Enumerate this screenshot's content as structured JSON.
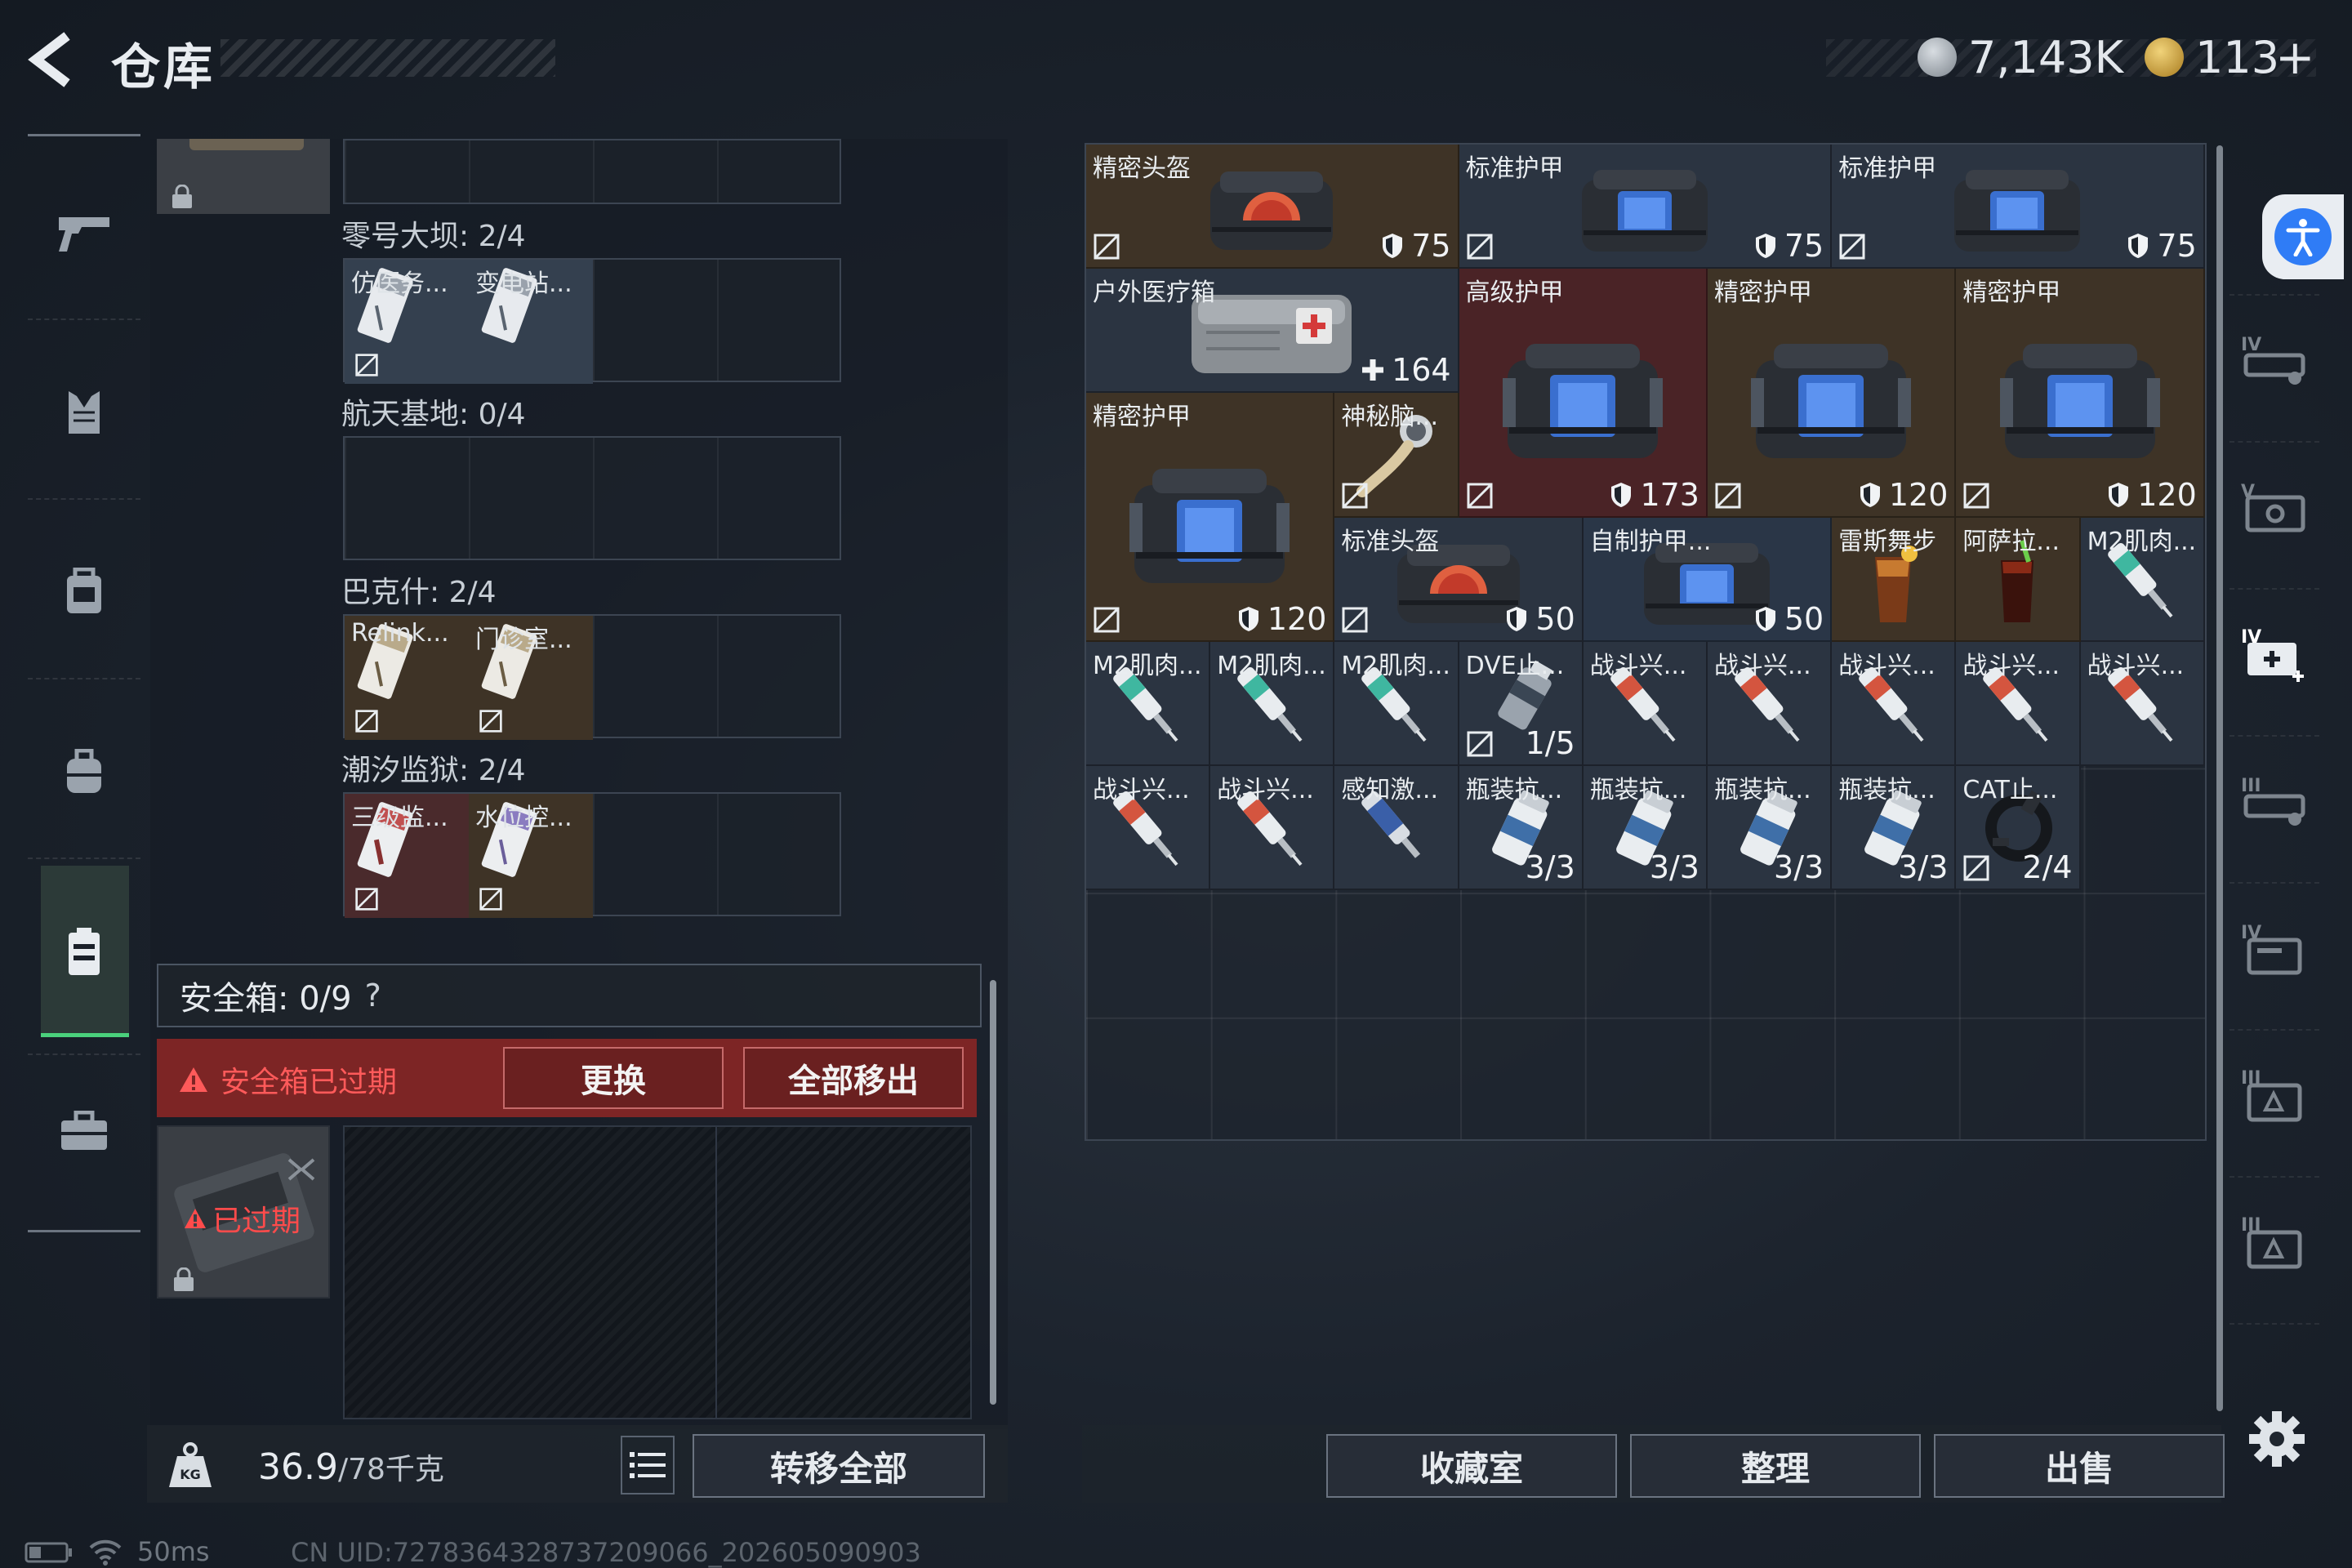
{
  "header": {
    "title": "仓库"
  },
  "currency": {
    "silver": "7,143K",
    "gold": "113",
    "plus": "+"
  },
  "left": {
    "regions": [
      {
        "label": "零号大坝: 2/4",
        "items": [
          "仿医务...",
          "变电站..."
        ]
      },
      {
        "label": "航天基地: 0/4",
        "items": []
      },
      {
        "label": "巴克什: 2/4",
        "items": [
          "Relink...",
          "门诊室..."
        ]
      },
      {
        "label": "潮汐监狱: 2/4",
        "items": [
          "三级监...",
          "水位控..."
        ]
      }
    ],
    "safebox_label": "安全箱: 0/9",
    "safebox_help": "?",
    "warn_text": "安全箱已过期",
    "replace_btn": "更换",
    "move_all_btn": "全部移出",
    "expired_text": "已过期",
    "weight_current": "36.9",
    "weight_max": "/78千克",
    "transfer_all_btn": "转移全部"
  },
  "inventory": {
    "items": [
      {
        "name": "精密头盔",
        "value": "75"
      },
      {
        "name": "标准护甲",
        "value": "75"
      },
      {
        "name": "标准护甲",
        "value": "75"
      },
      {
        "name": "户外医疗箱",
        "value": "164"
      },
      {
        "name": "高级护甲",
        "value": "173"
      },
      {
        "name": "精密护甲",
        "value": "120"
      },
      {
        "name": "精密护甲",
        "value": "120"
      },
      {
        "name": "精密护甲",
        "value": "120"
      },
      {
        "name": "神秘脑...",
        "value": ""
      },
      {
        "name": "标准头盔",
        "value": "50"
      },
      {
        "name": "自制护甲...",
        "value": "50"
      },
      {
        "name": "雷斯舞步",
        "value": ""
      },
      {
        "name": "阿萨拉...",
        "value": ""
      },
      {
        "name": "M2肌肉...",
        "value": ""
      },
      {
        "name": "M2肌肉...",
        "value": ""
      },
      {
        "name": "M2肌肉...",
        "value": ""
      },
      {
        "name": "M2肌肉...",
        "value": ""
      },
      {
        "name": "DVE止...",
        "value": "1/5"
      },
      {
        "name": "战斗兴...",
        "value": ""
      },
      {
        "name": "战斗兴...",
        "value": ""
      },
      {
        "name": "战斗兴...",
        "value": ""
      },
      {
        "name": "战斗兴...",
        "value": ""
      },
      {
        "name": "战斗兴...",
        "value": ""
      },
      {
        "name": "战斗兴...",
        "value": ""
      },
      {
        "name": "战斗兴...",
        "value": ""
      },
      {
        "name": "感知激...",
        "value": ""
      },
      {
        "name": "瓶装抗...",
        "value": "3/3"
      },
      {
        "name": "瓶装抗...",
        "value": "3/3"
      },
      {
        "name": "瓶装抗...",
        "value": "3/3"
      },
      {
        "name": "瓶装抗...",
        "value": "3/3"
      },
      {
        "name": "CAT止...",
        "value": "2/4"
      }
    ]
  },
  "bottom_buttons": {
    "collection": "收藏室",
    "sort": "整理",
    "sell": "出售"
  },
  "status": {
    "ping": "50ms",
    "uid": "CN UID:7278364328737209066_202605090903"
  },
  "colors": {
    "accent_green": "#4ad17c",
    "warning_red": "#7d2525",
    "warning_text": "#ff5a5a"
  }
}
